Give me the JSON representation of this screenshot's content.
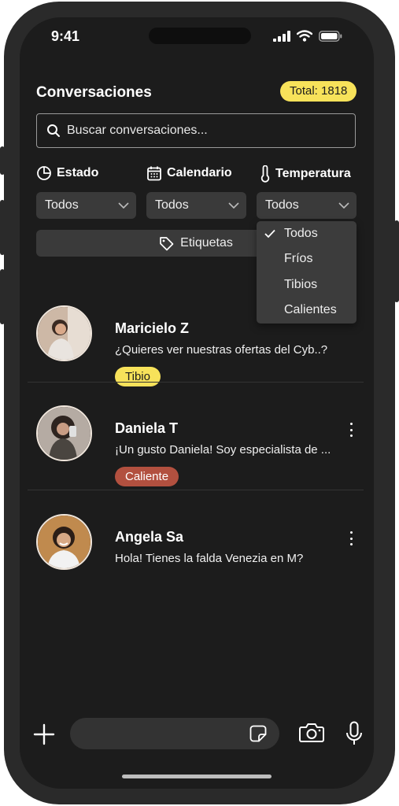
{
  "status_bar": {
    "time": "9:41"
  },
  "header": {
    "title": "Conversaciones",
    "total_badge": "Total: 1818"
  },
  "search": {
    "placeholder": "Buscar conversaciones..."
  },
  "filters": [
    {
      "label": "Estado",
      "icon": "pie-chart-icon",
      "selected": "Todos"
    },
    {
      "label": "Calendario",
      "icon": "calendar-icon",
      "selected": "Todos"
    },
    {
      "label": "Temperatura",
      "icon": "thermometer-icon",
      "selected": "Todos"
    }
  ],
  "tags_button": {
    "label": "Etiquetas",
    "icon": "tag-icon"
  },
  "temperature_dropdown": {
    "options": [
      "Todos",
      "Fríos",
      "Tibios",
      "Calientes"
    ],
    "selected": "Todos"
  },
  "conversations": [
    {
      "name": "Maricielo Z",
      "message": "¿Quieres ver nuestras ofertas del Cyb..?",
      "tag": "Tibio"
    },
    {
      "name": "Daniela T",
      "message": "¡Un gusto Daniela! Soy especialista de ...",
      "tag": "Caliente"
    },
    {
      "name": "Angela Sa",
      "message": "Hola! Tienes la falda Venezia en M?",
      "tag": ""
    }
  ],
  "colors": {
    "accent": "#f7e25a",
    "hot": "#b2503f",
    "background": "#1c1c1c",
    "control": "#3a3a3a"
  }
}
